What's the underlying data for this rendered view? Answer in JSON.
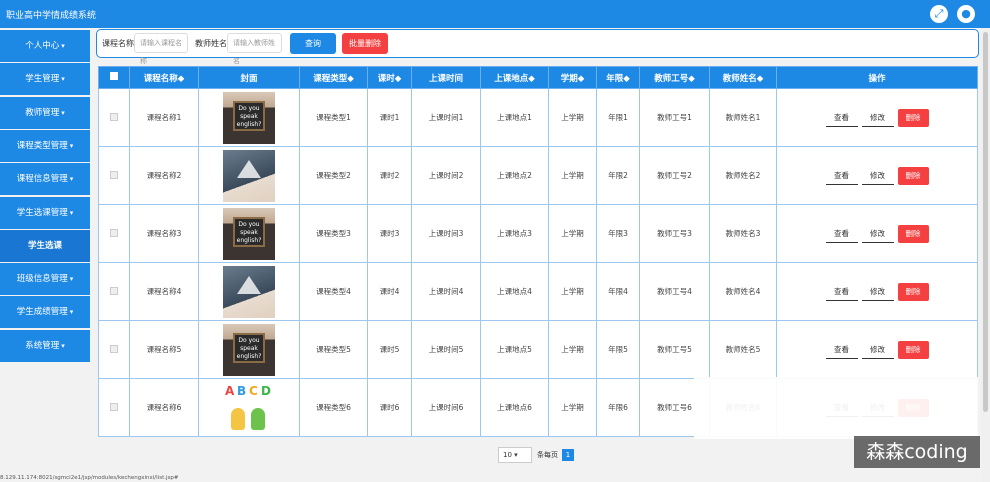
{
  "app": {
    "title": "职业高中学情成绩系统"
  },
  "header": {
    "fullscreen_icon": "expand-icon",
    "user_icon": "user-icon"
  },
  "sidebar": {
    "items": [
      {
        "label": "个人中心",
        "caret": true,
        "active": false
      },
      {
        "label": "学生管理",
        "caret": true,
        "active": false
      },
      {
        "label": "教师管理",
        "caret": true,
        "active": false
      },
      {
        "label": "课程类型管理",
        "caret": true,
        "active": false
      },
      {
        "label": "课程信息管理",
        "caret": true,
        "active": false
      },
      {
        "label": "学生选课管理",
        "caret": true,
        "active": false
      },
      {
        "label": "学生选课",
        "caret": false,
        "active": true
      },
      {
        "label": "班级信息管理",
        "caret": true,
        "active": false
      },
      {
        "label": "学生成绩管理",
        "caret": true,
        "active": false
      },
      {
        "label": "系统管理",
        "caret": true,
        "active": false
      }
    ]
  },
  "search": {
    "course_name_label": "课程名称",
    "course_name_placeholder": "请输入课程名称",
    "teacher_name_label": "教师姓名",
    "teacher_name_placeholder": "请输入教师姓名",
    "query_button": "查询",
    "batch_delete_button": "批量删除"
  },
  "chart_data": {
    "type": "table",
    "columns": [
      "",
      "课程名称◆",
      "封面",
      "课程类型◆",
      "课时◆",
      "上课时间",
      "上课地点◆",
      "学期◆",
      "年限◆",
      "教师工号◆",
      "教师姓名◆",
      "操作"
    ],
    "rows": [
      {
        "name": "课程名称1",
        "cover": "a",
        "type": "课程类型1",
        "hours": "课时1",
        "time": "上课时间1",
        "place": "上课地点1",
        "term": "上学期",
        "year": "年限1",
        "tno": "教师工号1",
        "tname": "教师姓名1"
      },
      {
        "name": "课程名称2",
        "cover": "b",
        "type": "课程类型2",
        "hours": "课时2",
        "time": "上课时间2",
        "place": "上课地点2",
        "term": "上学期",
        "year": "年限2",
        "tno": "教师工号2",
        "tname": "教师姓名2"
      },
      {
        "name": "课程名称3",
        "cover": "a",
        "type": "课程类型3",
        "hours": "课时3",
        "time": "上课时间3",
        "place": "上课地点3",
        "term": "上学期",
        "year": "年限3",
        "tno": "教师工号3",
        "tname": "教师姓名3"
      },
      {
        "name": "课程名称4",
        "cover": "b",
        "type": "课程类型4",
        "hours": "课时4",
        "time": "上课时间4",
        "place": "上课地点4",
        "term": "上学期",
        "year": "年限4",
        "tno": "教师工号4",
        "tname": "教师姓名4"
      },
      {
        "name": "课程名称5",
        "cover": "a",
        "type": "课程类型5",
        "hours": "课时5",
        "time": "上课时间5",
        "place": "上课地点5",
        "term": "上学期",
        "year": "年限5",
        "tno": "教师工号5",
        "tname": "教师姓名5"
      },
      {
        "name": "课程名称6",
        "cover": "c",
        "type": "课程类型6",
        "hours": "课时6",
        "time": "上课时间6",
        "place": "上课地点6",
        "term": "上学期",
        "year": "年限6",
        "tno": "教师工号6",
        "tname": "教师姓名6"
      }
    ],
    "actions": {
      "view": "查看",
      "edit": "修改",
      "delete": "删除"
    },
    "cover_text": "Do you speak english?",
    "cover_letters": [
      "A",
      "B",
      "C",
      "D"
    ]
  },
  "pagination": {
    "page_size": "10",
    "per_page_label": "条每页",
    "current_page": "1"
  },
  "watermark": "森森coding",
  "status_url": "8.129.11.174:8021/sgmci2e1/jsp/modules/kechengxinxi/list.jsp#",
  "colors": {
    "primary": "#1e88e5",
    "danger": "#f44040"
  }
}
